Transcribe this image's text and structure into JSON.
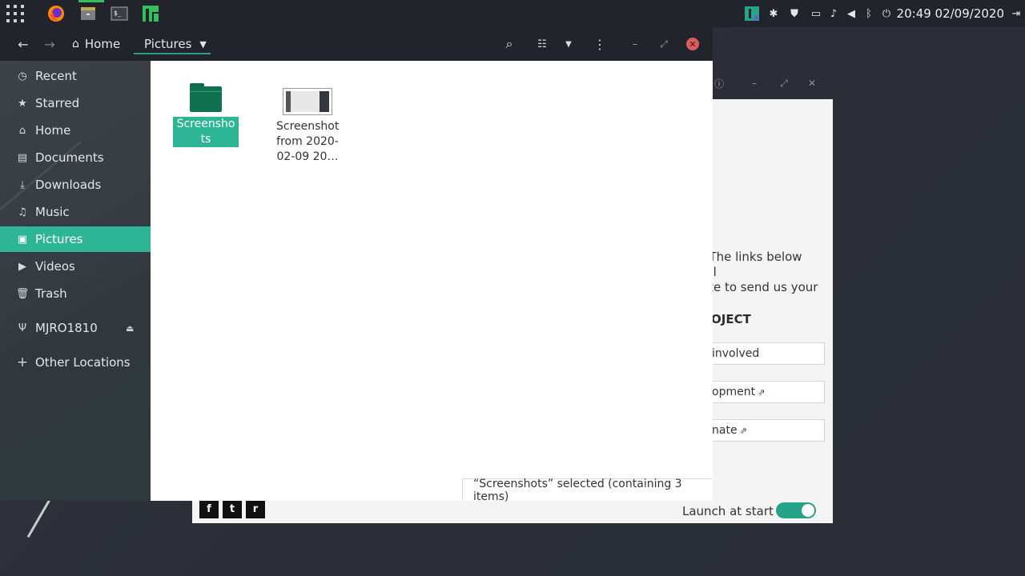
{
  "top_panel": {
    "clock": "20:49 02/09/2020",
    "launchers": [
      "firefox-icon",
      "files-icon",
      "terminal-icon",
      "manjaro-icon"
    ]
  },
  "file_manager": {
    "breadcrumbs": [
      "Home",
      "Pictures"
    ],
    "sidebar": {
      "items": [
        {
          "label": "Recent",
          "icon": "clock-icon"
        },
        {
          "label": "Starred",
          "icon": "star-icon"
        },
        {
          "label": "Home",
          "icon": "home-icon"
        },
        {
          "label": "Documents",
          "icon": "document-icon"
        },
        {
          "label": "Downloads",
          "icon": "download-icon"
        },
        {
          "label": "Music",
          "icon": "music-icon"
        },
        {
          "label": "Pictures",
          "icon": "picture-icon"
        },
        {
          "label": "Videos",
          "icon": "video-icon"
        },
        {
          "label": "Trash",
          "icon": "trash-icon"
        },
        {
          "label": "MJRO1810",
          "icon": "usb-icon"
        },
        {
          "label": "Other Locations",
          "icon": "plus-icon"
        }
      ],
      "active": "Pictures"
    },
    "files": [
      {
        "name": "Screenshots",
        "type": "folder",
        "selected": true
      },
      {
        "name": "Screenshot from 2020-02-09 20…",
        "type": "image",
        "selected": false
      }
    ],
    "status": "“Screenshots” selected  (containing 3 items)"
  },
  "background_window": {
    "text_line1": "t. The links below will",
    "text_line2": "tate to send us your",
    "heading": "OJECT",
    "buttons": [
      "involved",
      "opment",
      "nate"
    ],
    "launch_label": "Launch at start",
    "launch_enabled": true,
    "social": [
      "f",
      "t",
      "r"
    ]
  },
  "colors": {
    "accent": "#2db596",
    "panel": "#21242b",
    "close": "#e05b5b"
  }
}
